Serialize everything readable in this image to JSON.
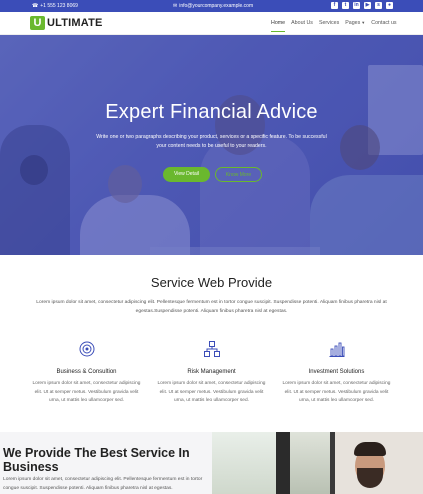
{
  "topbar": {
    "phone": "+1 555 123 8069",
    "email": "info@yourcompany.example.com",
    "socials": [
      "facebook-icon",
      "twitter-icon",
      "linkedin-icon",
      "youtube-icon",
      "skype-icon",
      "github-icon"
    ]
  },
  "logo": {
    "mark": "U",
    "text": "ULTIMATE"
  },
  "nav": {
    "items": [
      {
        "label": "Home"
      },
      {
        "label": "About Us"
      },
      {
        "label": "Services"
      },
      {
        "label": "Pages"
      },
      {
        "label": "Contact us"
      }
    ]
  },
  "hero": {
    "title": "Expert Financial Advice",
    "text": "Write one or two paragraphs describing your product, services or a specific feature. To be successful your content needs to be useful to your readers.",
    "primary_button": "View Detail",
    "secondary_button": "Know More"
  },
  "services": {
    "title": "Service Web Provide",
    "text": "Lorem ipsum dolor sit amet, consectetur adipiscing elit. Pellentesque fermentum est in tortor congue suscipit. Suspendisse potenti. Aliquam finibus pharetra nisl at egestas.Suspendisse potenti. Aliquam finibus pharetra nisl at egestas.",
    "items": [
      {
        "name": "Business & Consultion",
        "desc": "Lorem ipsum dolor sit amet, consectetur adipiscing elit. Ut at semper metus. Vestibulum gravida velit urna, ut mattis leo ullamcorper sed."
      },
      {
        "name": "Risk Management",
        "desc": "Lorem ipsum dolor sit amet, consectetur adipiscing elit. Ut at semper metus. Vestibulum gravida velit urna, ut mattis leo ullamcorper sed."
      },
      {
        "name": "Investment Solutions",
        "desc": "Lorem ipsum dolor sit amet, consectetur adipiscing elit. Ut at semper metus. Vestibulum gravida velit urna, ut mattis leo ullamcorper sed."
      }
    ]
  },
  "about": {
    "title": "We Provide The Best Service In Business",
    "text": "Lorem ipsum dolor sit amet, consectetur adipiscing elit. Pellentesque fermentum est in tortor congue suscipit. Suspendisse potenti. Aliquam finibus pharetra nisl at egestas."
  },
  "colors": {
    "brand_blue": "#3b4db8",
    "accent_green": "#6ab82e"
  }
}
